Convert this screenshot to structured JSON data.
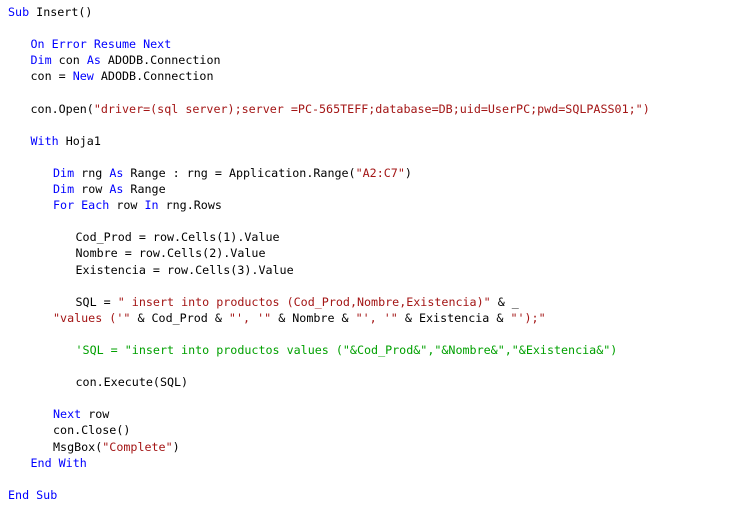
{
  "document": {
    "kind": "source-code-listing",
    "language": "VBA",
    "background_color": "#ffffff",
    "colors": {
      "keyword": "#0000ff",
      "string": "#a31515",
      "comment": "#00a000",
      "plain": "#000000"
    }
  },
  "code": {
    "lines": [
      {
        "indent": 0,
        "tokens": [
          {
            "t": "kw",
            "s": "Sub"
          },
          {
            "t": "txt",
            "s": " Insert()"
          }
        ]
      },
      {
        "indent": 0,
        "tokens": []
      },
      {
        "indent": 1,
        "tokens": [
          {
            "t": "kw",
            "s": "On Error Resume Next"
          }
        ]
      },
      {
        "indent": 1,
        "tokens": [
          {
            "t": "kw",
            "s": "Dim"
          },
          {
            "t": "txt",
            "s": " con "
          },
          {
            "t": "kw",
            "s": "As"
          },
          {
            "t": "txt",
            "s": " ADODB.Connection"
          }
        ]
      },
      {
        "indent": 1,
        "tokens": [
          {
            "t": "txt",
            "s": "con = "
          },
          {
            "t": "kw",
            "s": "New"
          },
          {
            "t": "txt",
            "s": " ADODB.Connection"
          }
        ]
      },
      {
        "indent": 0,
        "tokens": []
      },
      {
        "indent": 1,
        "tokens": [
          {
            "t": "txt",
            "s": "con.Open("
          },
          {
            "t": "str",
            "s": "\"driver=(sql server);server =PC-565TEFF;database=DB;uid=UserPC;pwd=SQLPASS01;\")"
          }
        ]
      },
      {
        "indent": 0,
        "tokens": []
      },
      {
        "indent": 1,
        "tokens": [
          {
            "t": "kw",
            "s": "With"
          },
          {
            "t": "txt",
            "s": " Hoja1"
          }
        ]
      },
      {
        "indent": 0,
        "tokens": []
      },
      {
        "indent": 2,
        "tokens": [
          {
            "t": "kw",
            "s": "Dim"
          },
          {
            "t": "txt",
            "s": " rng "
          },
          {
            "t": "kw",
            "s": "As"
          },
          {
            "t": "txt",
            "s": " Range : rng = Application.Range("
          },
          {
            "t": "str",
            "s": "\"A2:C7\""
          },
          {
            "t": "txt",
            "s": ")"
          }
        ]
      },
      {
        "indent": 2,
        "tokens": [
          {
            "t": "kw",
            "s": "Dim"
          },
          {
            "t": "txt",
            "s": " row "
          },
          {
            "t": "kw",
            "s": "As"
          },
          {
            "t": "txt",
            "s": " Range"
          }
        ]
      },
      {
        "indent": 2,
        "tokens": [
          {
            "t": "kw",
            "s": "For Each"
          },
          {
            "t": "txt",
            "s": " row "
          },
          {
            "t": "kw",
            "s": "In"
          },
          {
            "t": "txt",
            "s": " rng.Rows"
          }
        ]
      },
      {
        "indent": 0,
        "tokens": []
      },
      {
        "indent": 3,
        "tokens": [
          {
            "t": "txt",
            "s": "Cod_Prod = row.Cells(1).Value"
          }
        ]
      },
      {
        "indent": 3,
        "tokens": [
          {
            "t": "txt",
            "s": "Nombre = row.Cells(2).Value"
          }
        ]
      },
      {
        "indent": 3,
        "tokens": [
          {
            "t": "txt",
            "s": "Existencia = row.Cells(3).Value"
          }
        ]
      },
      {
        "indent": 0,
        "tokens": []
      },
      {
        "indent": 3,
        "tokens": [
          {
            "t": "txt",
            "s": "SQL = "
          },
          {
            "t": "str",
            "s": "\" insert into productos (Cod_Prod,Nombre,Existencia)\""
          },
          {
            "t": "txt",
            "s": " & _"
          }
        ]
      },
      {
        "indent": 2,
        "tokens": [
          {
            "t": "str",
            "s": "\"values ('\""
          },
          {
            "t": "txt",
            "s": " & Cod_Prod & "
          },
          {
            "t": "str",
            "s": "\"', '\""
          },
          {
            "t": "txt",
            "s": " & Nombre & "
          },
          {
            "t": "str",
            "s": "\"', '\""
          },
          {
            "t": "txt",
            "s": " & Existencia & "
          },
          {
            "t": "str",
            "s": "\"');\""
          }
        ]
      },
      {
        "indent": 0,
        "tokens": []
      },
      {
        "indent": 3,
        "tokens": [
          {
            "t": "cmt",
            "s": "'SQL = \"insert into productos values (\"&Cod_Prod&\",\"&Nombre&\",\"&Existencia&\")"
          }
        ]
      },
      {
        "indent": 0,
        "tokens": []
      },
      {
        "indent": 3,
        "tokens": [
          {
            "t": "txt",
            "s": "con.Execute(SQL)"
          }
        ]
      },
      {
        "indent": 0,
        "tokens": []
      },
      {
        "indent": 2,
        "tokens": [
          {
            "t": "kw",
            "s": "Next"
          },
          {
            "t": "txt",
            "s": " row"
          }
        ]
      },
      {
        "indent": 2,
        "tokens": [
          {
            "t": "txt",
            "s": "con.Close()"
          }
        ]
      },
      {
        "indent": 2,
        "tokens": [
          {
            "t": "txt",
            "s": "MsgBox("
          },
          {
            "t": "str",
            "s": "\"Complete\""
          },
          {
            "t": "txt",
            "s": ")"
          }
        ]
      },
      {
        "indent": 1,
        "tokens": [
          {
            "t": "kw",
            "s": "End With"
          }
        ]
      },
      {
        "indent": 0,
        "tokens": []
      },
      {
        "indent": 0,
        "tokens": [
          {
            "t": "kw",
            "s": "End Sub"
          }
        ]
      }
    ]
  }
}
